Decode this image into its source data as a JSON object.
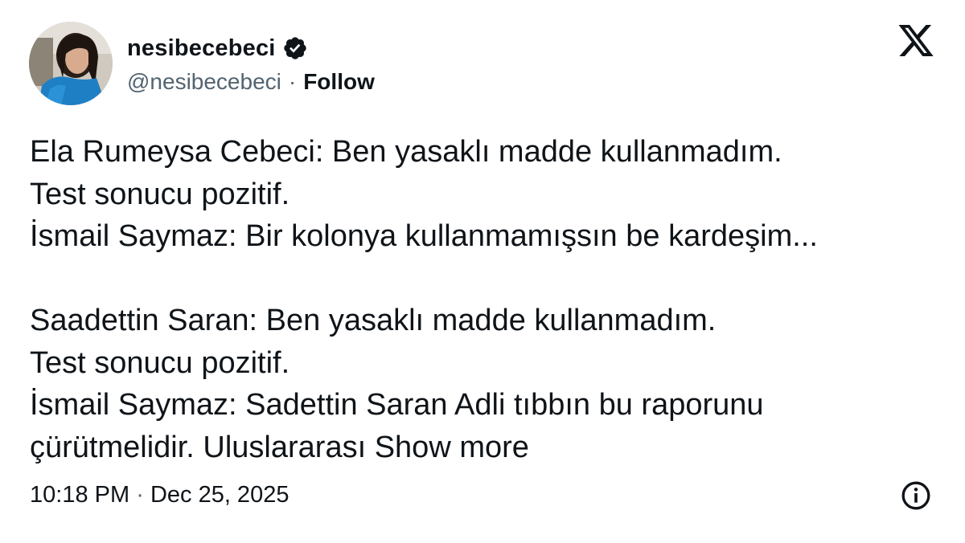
{
  "user": {
    "display_name": "nesibecebeci",
    "handle": "@nesibecebeci",
    "separator": "·",
    "follow_label": "Follow",
    "verified_icon": "verified-badge-icon"
  },
  "platform_icon": "x-logo-icon",
  "tweet": {
    "lines": [
      "Ela Rumeysa Cebeci: Ben yasaklı madde kullanmadım.",
      "Test sonucu pozitif.",
      "İsmail Saymaz: Bir kolonya kullanmamışsın be kardeşim...",
      "",
      "Saadettin Saran: Ben yasaklı madde kullanmadım.",
      "Test sonucu pozitif.",
      "İsmail Saymaz: Sadettin Saran Adli tıbbın bu raporunu"
    ],
    "last_line_text": "çürütmelidir. Uluslararası",
    "show_more_label": "Show more"
  },
  "timestamp": {
    "time": "10:18 PM",
    "separator": "·",
    "date": "Dec 25, 2025"
  },
  "info_icon": "info-icon",
  "colors": {
    "text": "#0f1419",
    "secondary": "#536471",
    "verified_fill": "#0f1419"
  }
}
